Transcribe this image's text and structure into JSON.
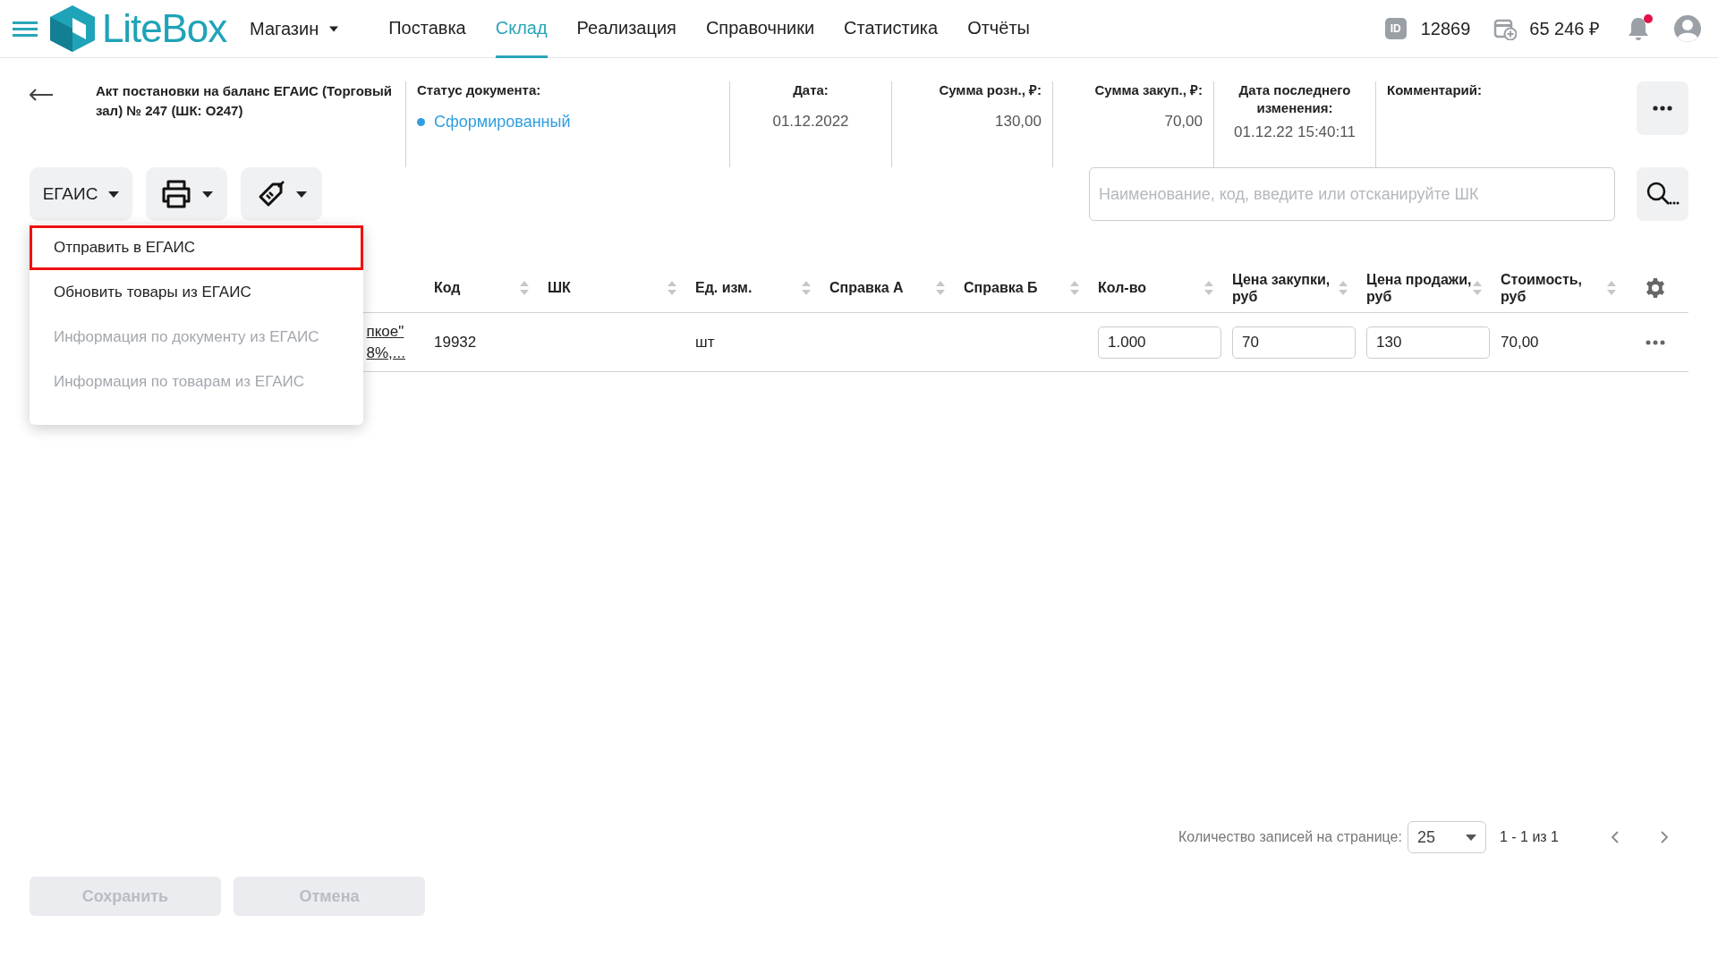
{
  "top_bar": {
    "logo": "LiteBox",
    "store": "Магазин",
    "id_label": "ID",
    "account_id": "12869",
    "balance": "65 246 ₽",
    "notifications_unread": true,
    "nav": [
      {
        "label": "Поставка",
        "selected": false
      },
      {
        "label": "Склад",
        "selected": true
      },
      {
        "label": "Реализация",
        "selected": false
      },
      {
        "label": "Справочники",
        "selected": false
      },
      {
        "label": "Статистика",
        "selected": false
      },
      {
        "label": "Отчёты",
        "selected": false
      }
    ]
  },
  "document": {
    "title": "Акт постановки на баланс ЕГАИС (Торговый зал) № 247 (ШК: О247)",
    "status": {
      "label": "Статус документа:",
      "value": "Сформированный",
      "color": "#2f9fe0"
    },
    "date": {
      "label": "Дата:",
      "value": "01.12.2022"
    },
    "retail_sum": {
      "label": "Сумма розн., ₽:",
      "value": "130,00"
    },
    "purchase_sum": {
      "label": "Сумма закуп., ₽:",
      "value": "70,00"
    },
    "last_modified": {
      "label": "Дата последнего изменения:",
      "value": "01.12.22 15:40:11"
    },
    "comment": {
      "label": "Комментарий:"
    }
  },
  "toolbar": {
    "egais_button": "ЕГАИС",
    "search": {
      "placeholder": "Наименование, код, введите или отсканируйте ШК"
    }
  },
  "egais_menu": [
    {
      "label": "Отправить в ЕГАИС",
      "disabled": false,
      "highlighted": true
    },
    {
      "label": "Обновить товары из ЕГАИС",
      "disabled": false,
      "highlighted": false
    },
    {
      "label": "Информация по документу из ЕГАИС",
      "disabled": true,
      "highlighted": false
    },
    {
      "label": "Информация по товарам из ЕГАИС",
      "disabled": true,
      "highlighted": false
    }
  ],
  "table": {
    "columns": [
      "Код",
      "ШК",
      "Ед. изм.",
      "Справка А",
      "Справка Б",
      "Кол-во",
      "Цена закупки, руб",
      "Цена продажи, руб",
      "Стоимость, руб"
    ],
    "rows": [
      {
        "name_lines": [
          "пкое\"",
          "8%,..."
        ],
        "code": "19932",
        "unit": "шт",
        "quantity": "1.000",
        "purchase_price": "70",
        "sale_price": "130",
        "cost": "70,00"
      }
    ]
  },
  "pagination": {
    "label": "Количество записей на странице:",
    "page_size": "25",
    "range": "1 - 1 из 1"
  },
  "footer_buttons": [
    {
      "label": "Сохранить",
      "disabled": true
    },
    {
      "label": "Отмена",
      "disabled": true
    }
  ]
}
